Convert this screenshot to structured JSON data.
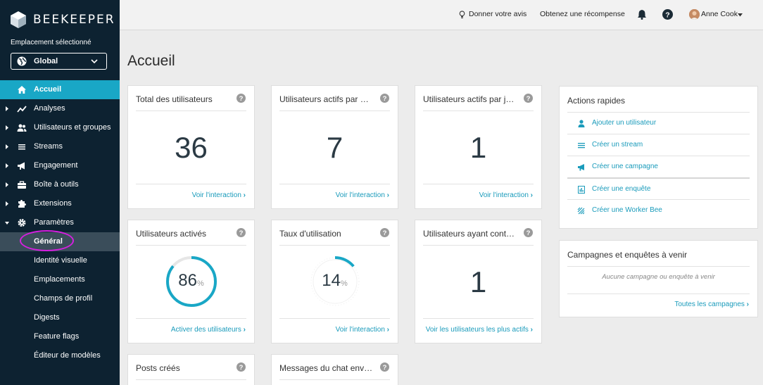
{
  "brand": {
    "name": "BEEKEEPER"
  },
  "location": {
    "label": "Emplacement sélectionné",
    "value": "Global"
  },
  "nav": {
    "items": [
      {
        "label": "Accueil",
        "icon": "home-icon"
      },
      {
        "label": "Analyses",
        "icon": "chart-line-icon"
      },
      {
        "label": "Utilisateurs et groupes",
        "icon": "users-icon"
      },
      {
        "label": "Streams",
        "icon": "list-icon"
      },
      {
        "label": "Engagement",
        "icon": "megaphone-icon"
      },
      {
        "label": "Boîte à outils",
        "icon": "toolbox-icon"
      },
      {
        "label": "Extensions",
        "icon": "puzzle-icon"
      },
      {
        "label": "Paramètres",
        "icon": "gear-icon"
      }
    ],
    "settings_sub": [
      "Général",
      "Identité visuelle",
      "Emplacements",
      "Champs de profil",
      "Digests",
      "Feature flags",
      "Éditeur de modèles"
    ]
  },
  "topbar": {
    "feedback": "Donner votre avis",
    "reward": "Obtenez une récompense",
    "user": "Anne Cook"
  },
  "page": {
    "title": "Accueil"
  },
  "cards": {
    "total_users": {
      "title": "Total des utilisateurs",
      "value": "36",
      "link": "Voir l'interaction"
    },
    "active_per_1": {
      "title": "Utilisateurs actifs par …",
      "value": "7",
      "link": "Voir l'interaction"
    },
    "active_per_2": {
      "title": "Utilisateurs actifs par j…",
      "value": "1",
      "link": "Voir l'interaction"
    },
    "activated": {
      "title": "Utilisateurs activés",
      "value": "86",
      "unit": "%",
      "percent": 86,
      "link": "Activer des utilisateurs"
    },
    "usage": {
      "title": "Taux d'utilisation",
      "value": "14",
      "unit": "%",
      "percent": 14,
      "link": "Voir l'interaction"
    },
    "contributed": {
      "title": "Utilisateurs ayant cont…",
      "value": "1",
      "link": "Voir les utilisateurs les plus actifs"
    },
    "posts": {
      "title": "Posts créés"
    },
    "chat": {
      "title": "Messages du chat env…"
    }
  },
  "quick_actions": {
    "title": "Actions rapides",
    "items": [
      {
        "label": "Ajouter un utilisateur",
        "icon": "user-icon"
      },
      {
        "label": "Créer un stream",
        "icon": "list-icon"
      },
      {
        "label": "Créer une campagne",
        "icon": "megaphone-icon"
      },
      {
        "label": "Créer une enquête",
        "icon": "survey-icon"
      },
      {
        "label": "Créer une Worker Bee",
        "icon": "worker-bee-icon"
      }
    ]
  },
  "upcoming": {
    "title": "Campagnes et enquêtes à venir",
    "empty": "Aucune campagne ou enquête à venir",
    "link": "Toutes les campagnes"
  },
  "colors": {
    "sidebar": "#0d2231",
    "accent": "#19a7c6",
    "link": "#1a9bbb",
    "highlight": "#d61fe0"
  }
}
